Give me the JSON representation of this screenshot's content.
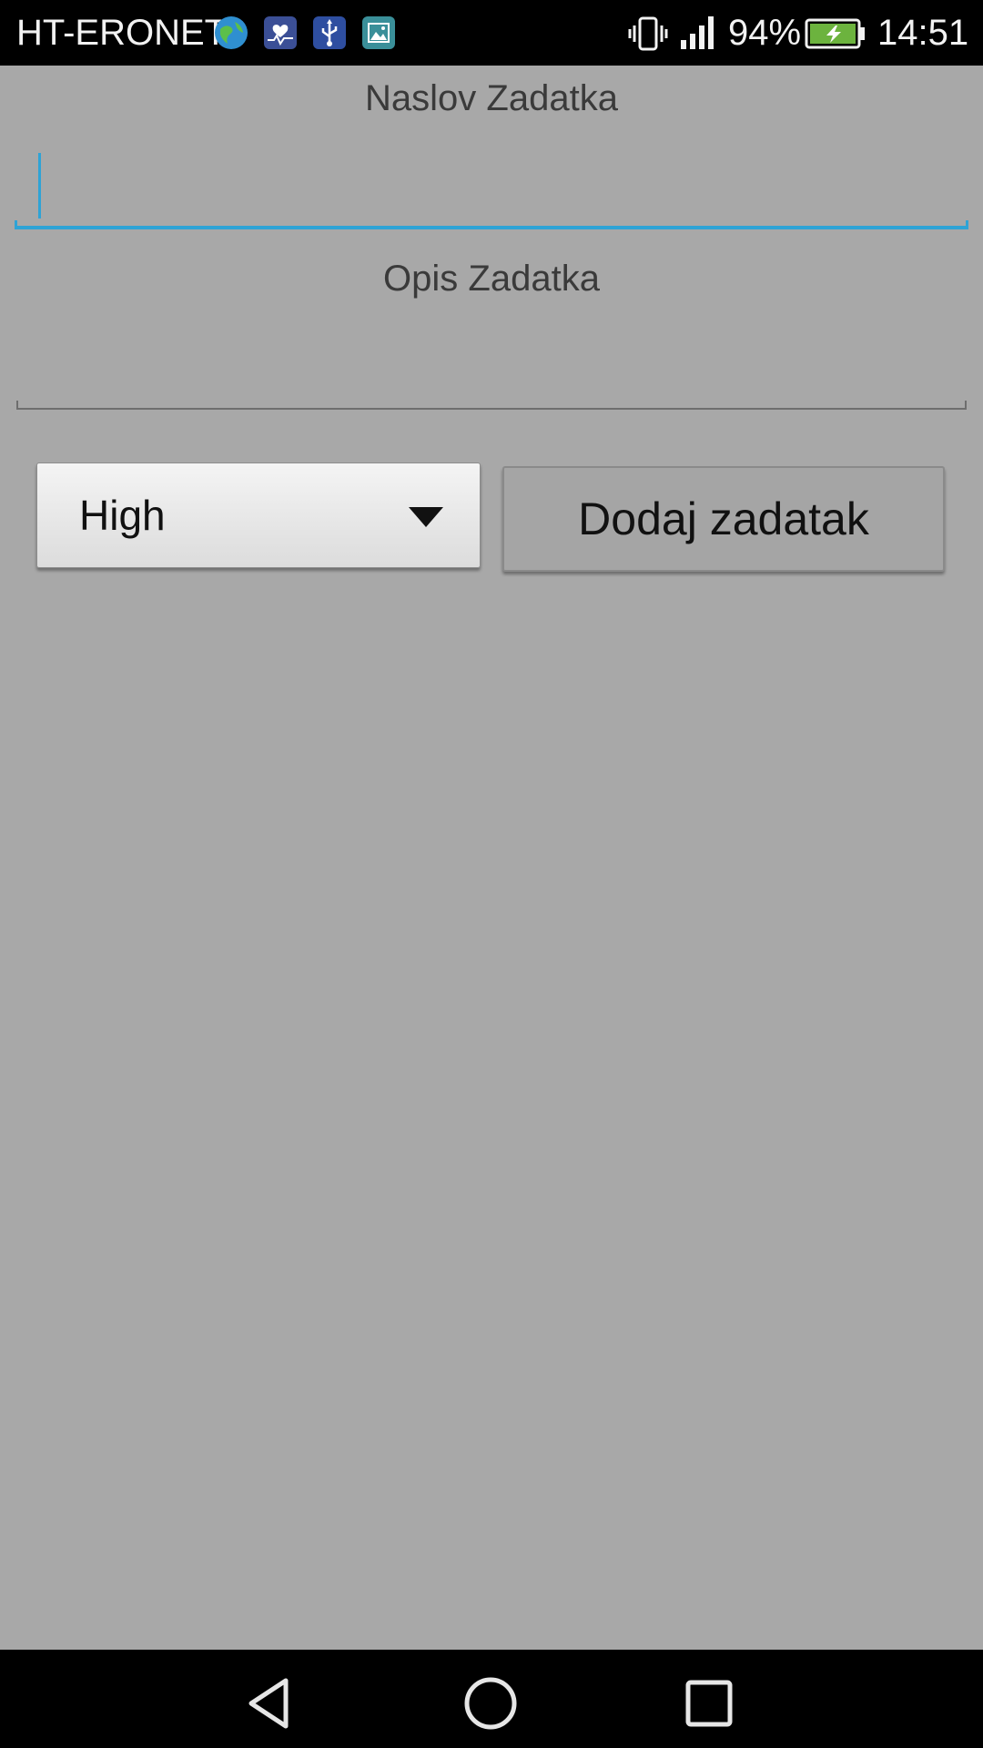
{
  "status_bar": {
    "carrier": "HT-ERONET",
    "notification_icons": [
      "globe-icon",
      "health-icon",
      "usb-icon",
      "gallery-icon"
    ],
    "battery_percent": "94%",
    "time": "14:51",
    "colors": {
      "background": "#000000",
      "text": "#f2f2f2",
      "battery_fill": "#6cb33e"
    }
  },
  "form": {
    "title_label": "Naslov Zadatka",
    "title_value": "",
    "description_label": "Opis Zadatka",
    "description_value": "",
    "priority_selected": "High",
    "add_button_label": "Dodaj zadatak",
    "colors": {
      "background": "#a8a8a8",
      "focus_accent": "#2ea3d6",
      "label_text": "#3a3a3a"
    }
  },
  "nav_bar": {
    "buttons": [
      "back-icon",
      "home-icon",
      "recents-icon"
    ]
  }
}
